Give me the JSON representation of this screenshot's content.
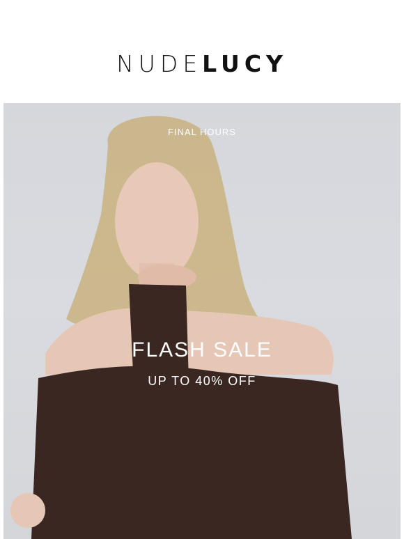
{
  "brand": {
    "logo_light": "NUDE",
    "logo_bold": "LUCY"
  },
  "hero": {
    "eyebrow": "FINAL HOURS",
    "headline": "FLASH SALE",
    "subline": "UP TO 40% OFF"
  },
  "colors": {
    "background": "#ffffff",
    "hero_bg": "#d7d9de",
    "garment": "#3a2722",
    "text_on_image": "#ffffff",
    "logo": "#111111"
  }
}
